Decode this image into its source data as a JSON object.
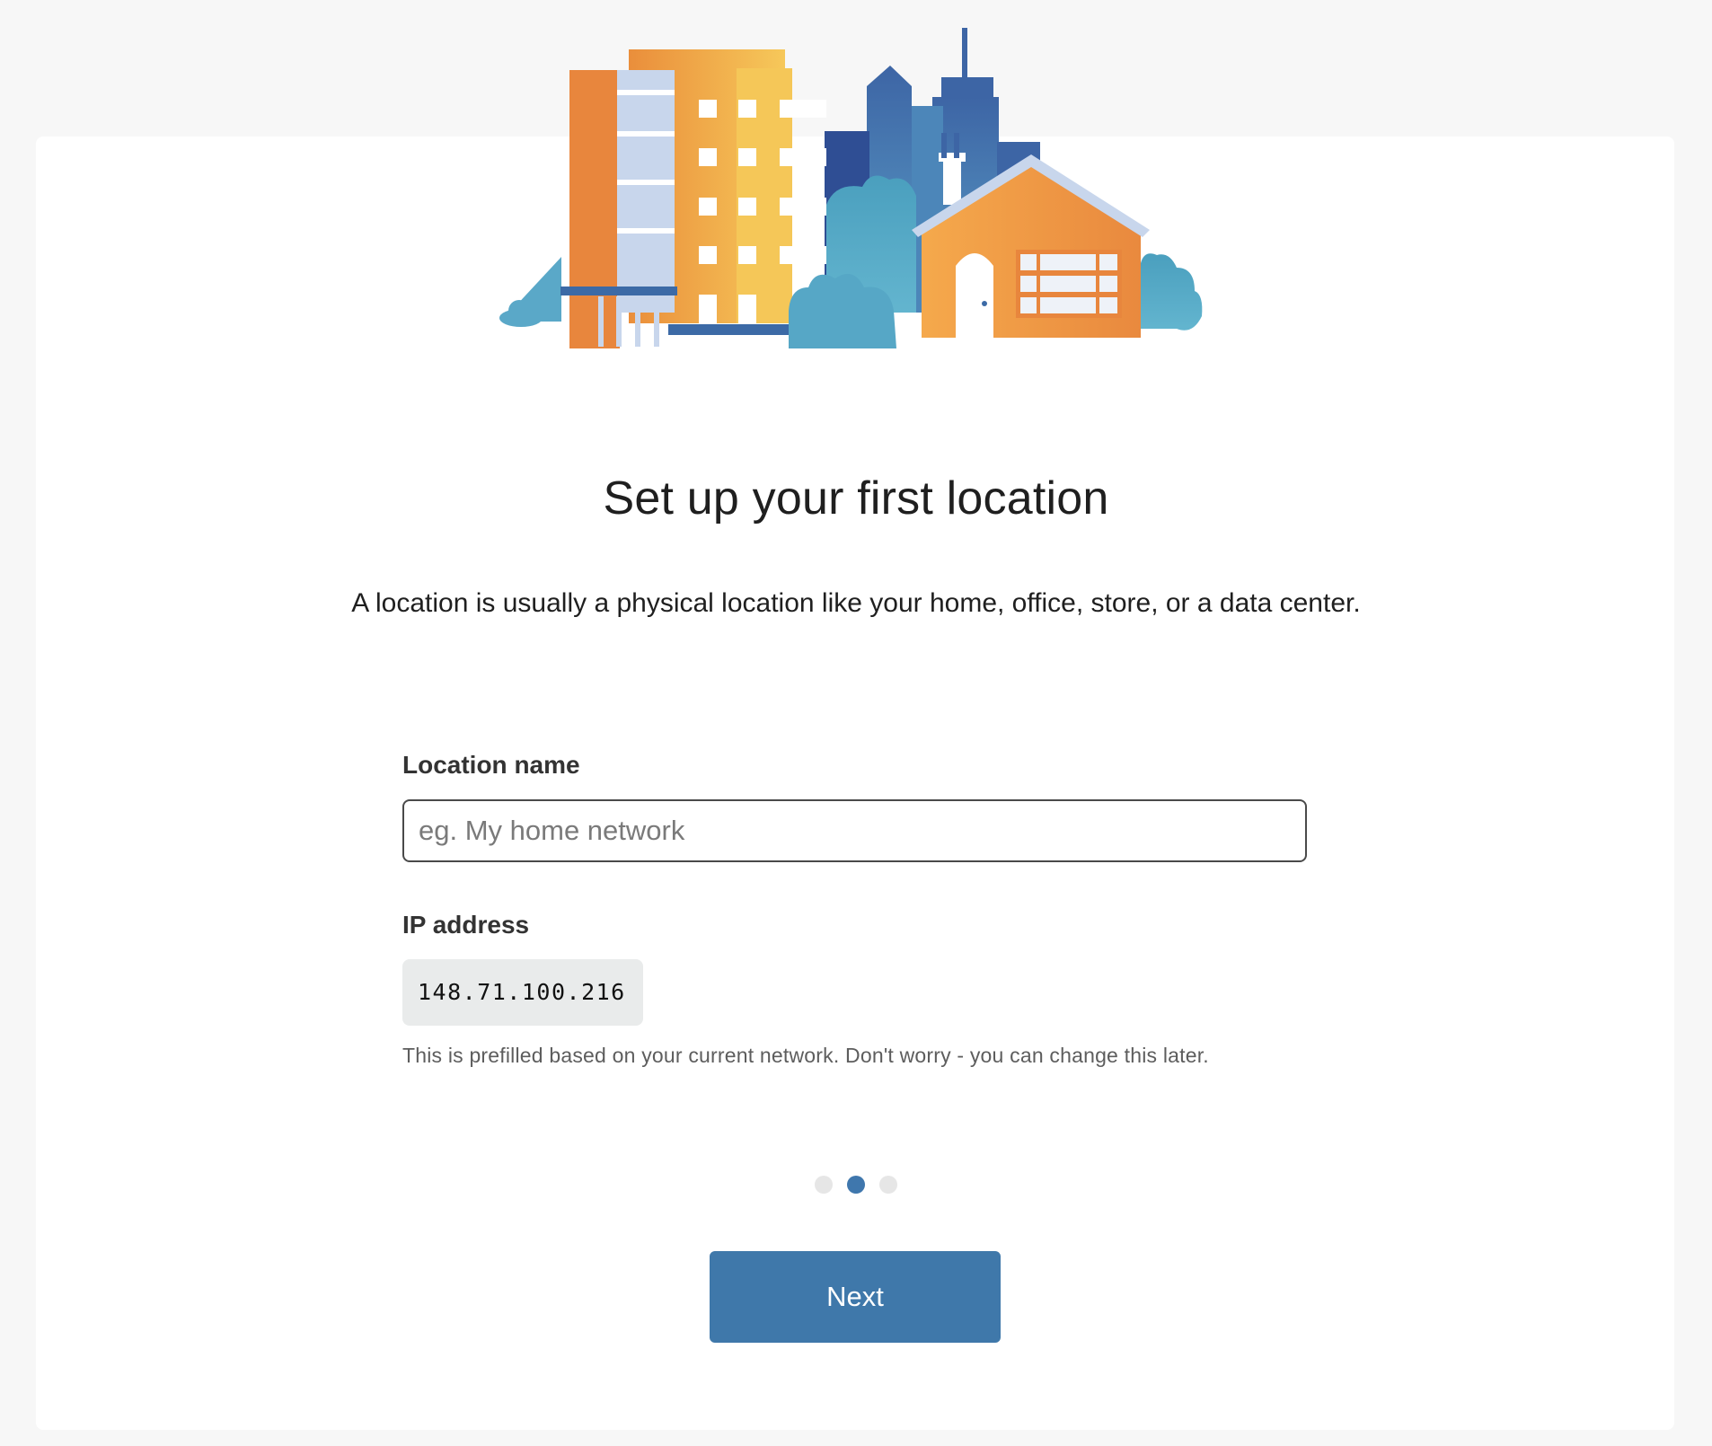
{
  "page": {
    "title": "Set up your first location",
    "subtitle": "A location is usually a physical location like your home, office, store, or a data center."
  },
  "form": {
    "location_name": {
      "label": "Location name",
      "placeholder": "eg. My home network",
      "value": ""
    },
    "ip_address": {
      "label": "IP address",
      "value": "148.71.100.216",
      "helper": "This is prefilled based on your current network. Don't worry - you can change this later."
    }
  },
  "progress": {
    "total_steps": 3,
    "current_step": 2
  },
  "actions": {
    "next_label": "Next"
  },
  "colors": {
    "accent": "#3f78aa",
    "active_dot": "#3f77ad",
    "inactive_dot": "#e6e6e6",
    "background": "#f7f7f7",
    "card": "#ffffff"
  },
  "illustration": {
    "icon": "city-and-house-illustration"
  }
}
